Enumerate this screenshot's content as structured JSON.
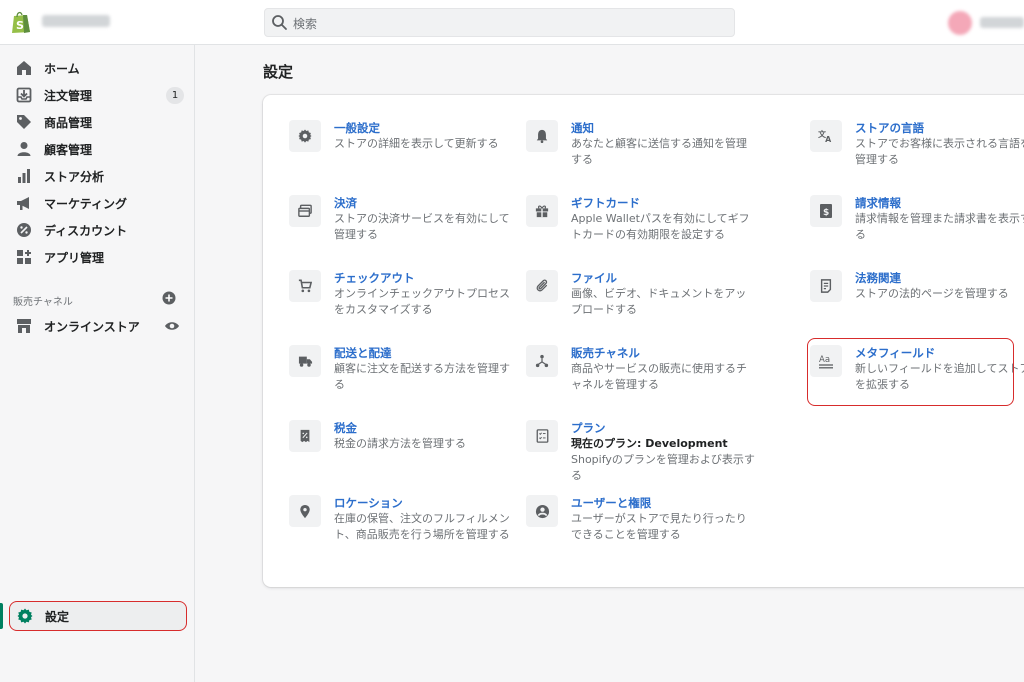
{
  "header": {
    "search_placeholder": "検索",
    "icons": {
      "logo": "shopify-bag-icon",
      "search": "search-icon"
    }
  },
  "sidebar": {
    "items": [
      {
        "label": "ホーム",
        "icon": "home-icon"
      },
      {
        "label": "注文管理",
        "icon": "orders-icon",
        "badge": "1"
      },
      {
        "label": "商品管理",
        "icon": "tag-icon"
      },
      {
        "label": "顧客管理",
        "icon": "person-icon"
      },
      {
        "label": "ストア分析",
        "icon": "analytics-icon"
      },
      {
        "label": "マーケティング",
        "icon": "megaphone-icon"
      },
      {
        "label": "ディスカウント",
        "icon": "discount-icon"
      },
      {
        "label": "アプリ管理",
        "icon": "apps-icon"
      }
    ],
    "sales_channels_label": "販売チャネル",
    "online_store_label": "オンラインストア",
    "settings_label": "設定"
  },
  "main": {
    "title": "設定",
    "settings": [
      {
        "title": "一般設定",
        "desc": "ストアの詳細を表示して更新する",
        "icon": "gear-icon"
      },
      {
        "title": "通知",
        "desc": "あなたと顧客に送信する通知を管理する",
        "icon": "bell-icon"
      },
      {
        "title": "ストアの言語",
        "desc": "ストアでお客様に表示される言語を管理する",
        "icon": "translate-icon"
      },
      {
        "title": "決済",
        "desc": "ストアの決済サービスを有効にして管理する",
        "icon": "payment-icon"
      },
      {
        "title": "ギフトカード",
        "desc": "Apple Walletパスを有効にしてギフトカードの有効期限を設定する",
        "icon": "gift-icon"
      },
      {
        "title": "請求情報",
        "desc": "請求情報を管理また請求書を表示する",
        "icon": "billing-icon"
      },
      {
        "title": "チェックアウト",
        "desc": "オンラインチェックアウトプロセスをカスタマイズする",
        "icon": "cart-icon"
      },
      {
        "title": "ファイル",
        "desc": "画像、ビデオ、ドキュメントをアップロードする",
        "icon": "paperclip-icon"
      },
      {
        "title": "法務関連",
        "desc": "ストアの法的ページを管理する",
        "icon": "legal-icon"
      },
      {
        "title": "配送と配達",
        "desc": "顧客に注文を配送する方法を管理する",
        "icon": "truck-icon"
      },
      {
        "title": "販売チャネル",
        "desc": "商品やサービスの販売に使用するチャネルを管理する",
        "icon": "channels-icon"
      },
      {
        "title": "メタフィールド",
        "desc": "新しいフィールドを追加してストアを拡張する",
        "icon": "metafields-icon"
      },
      {
        "title": "税金",
        "desc": "税金の請求方法を管理する",
        "icon": "tax-icon"
      },
      {
        "title": "プラン",
        "desc_strong": "現在のプラン: Development",
        "desc": "Shopifyのプランを管理および表示する",
        "icon": "plan-icon"
      },
      {
        "title": "ロケーション",
        "desc": "在庫の保管、注文のフルフィルメント、商品販売を行う場所を管理する",
        "icon": "location-pin-icon"
      },
      {
        "title": "ユーザーと権限",
        "desc": "ユーザーがストアで見たり行ったりできることを管理する",
        "icon": "user-circle-icon"
      }
    ]
  },
  "colors": {
    "accent_link": "#2c6ecb",
    "highlight_red": "#d72c2c",
    "shopify_green": "#008060",
    "settings_gear": "#008060"
  }
}
